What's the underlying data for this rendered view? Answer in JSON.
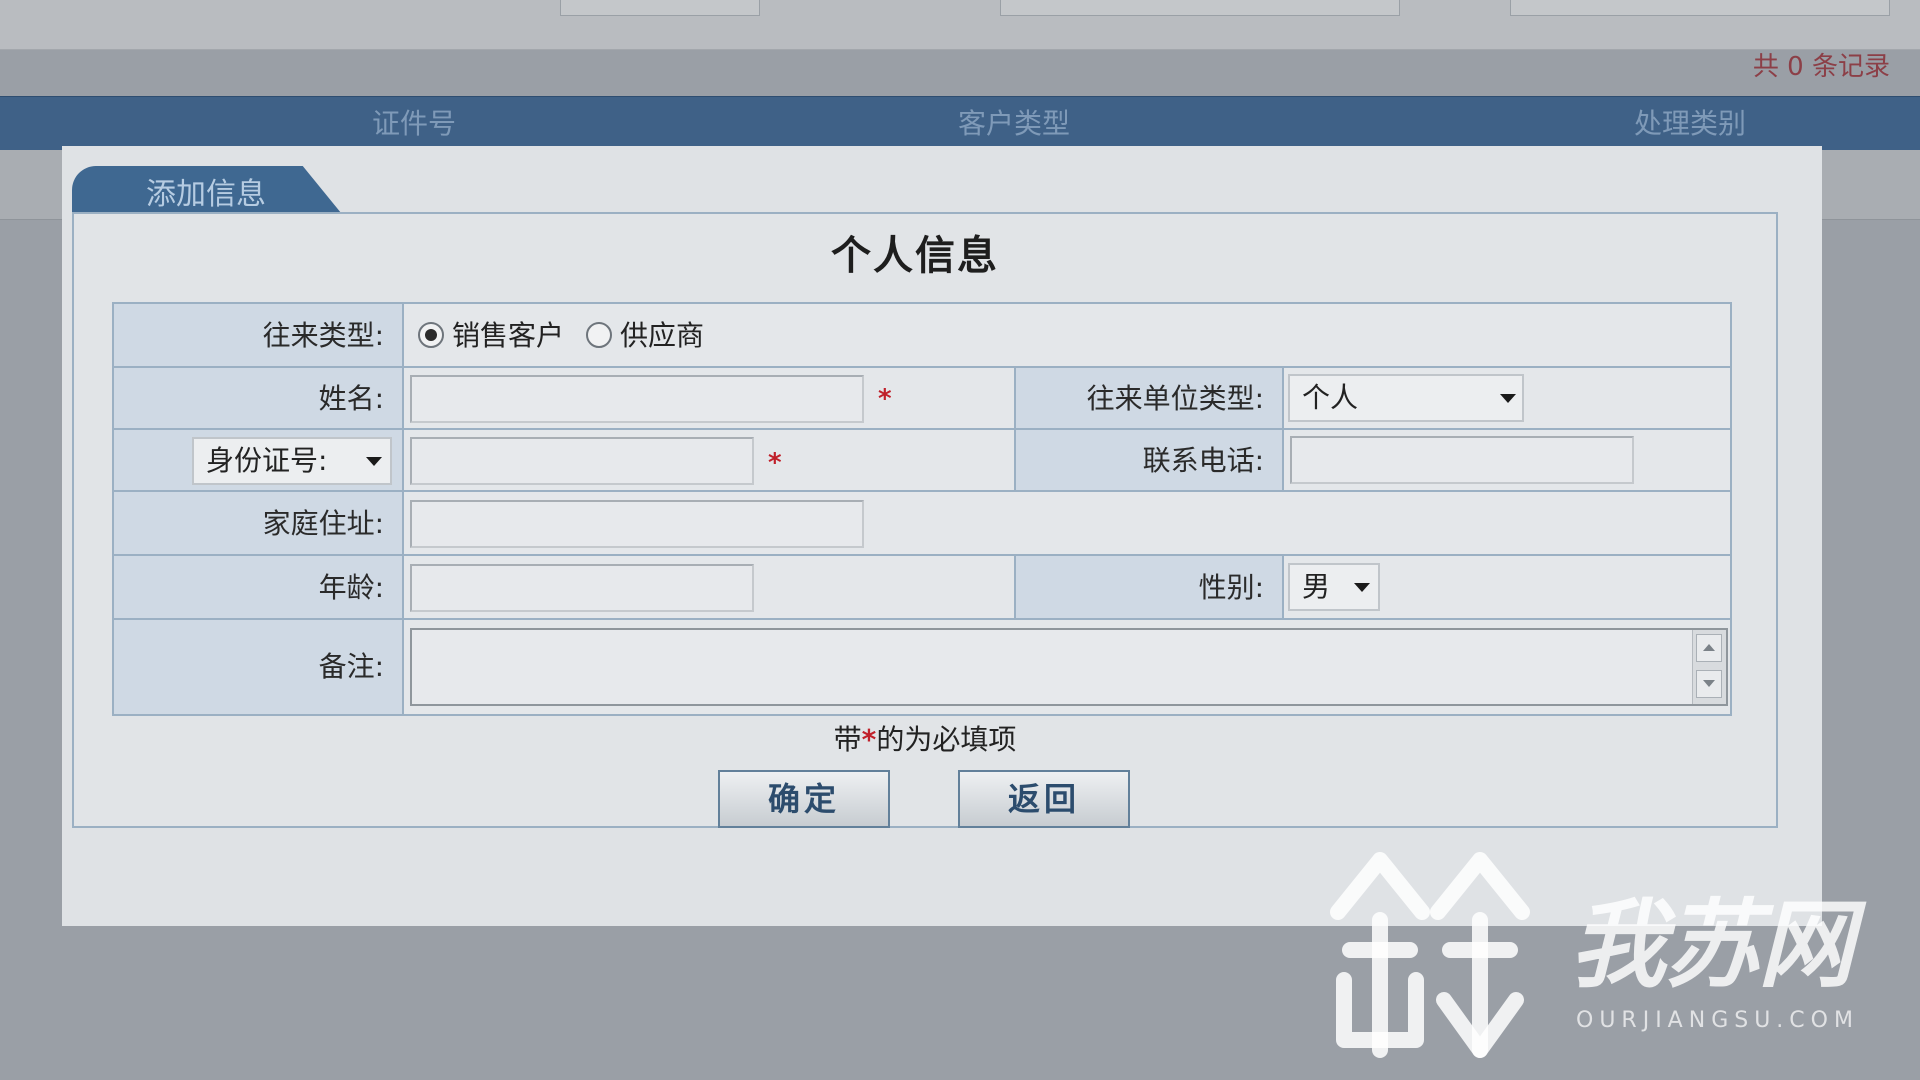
{
  "background": {
    "record_count": "共 0 条记录",
    "columns": [
      "证件号",
      "客户类型",
      "处理类别"
    ]
  },
  "dialog": {
    "tab_label": "添加信息",
    "title": "个人信息",
    "form": {
      "trade_type": {
        "label": "往来类型:",
        "options": [
          "销售客户",
          "供应商"
        ],
        "selected": "销售客户"
      },
      "name": {
        "label": "姓名:",
        "value": "",
        "required_mark": "*"
      },
      "unit_type": {
        "label": "往来单位类型:",
        "selected": "个人"
      },
      "id_type": {
        "selected": "身份证号:"
      },
      "id_number": {
        "value": "",
        "required_mark": "*"
      },
      "phone": {
        "label": "联系电话:",
        "value": ""
      },
      "address": {
        "label": "家庭住址:",
        "value": ""
      },
      "age": {
        "label": "年龄:",
        "value": ""
      },
      "gender": {
        "label": "性别:",
        "selected": "男"
      },
      "remarks": {
        "label": "备注:",
        "value": ""
      }
    },
    "note": {
      "prefix": "带",
      "mark": "*",
      "suffix": "的为必填项"
    },
    "buttons": {
      "confirm": "确定",
      "back": "返回"
    }
  },
  "watermark": {
    "brand": "我苏网",
    "domain": "OURJIANGSU.COM"
  },
  "colors": {
    "header_blue": "#3f6187",
    "label_bg": "#cfd9e4",
    "required_red": "#c0202a",
    "button_text": "#2c4c6d"
  }
}
